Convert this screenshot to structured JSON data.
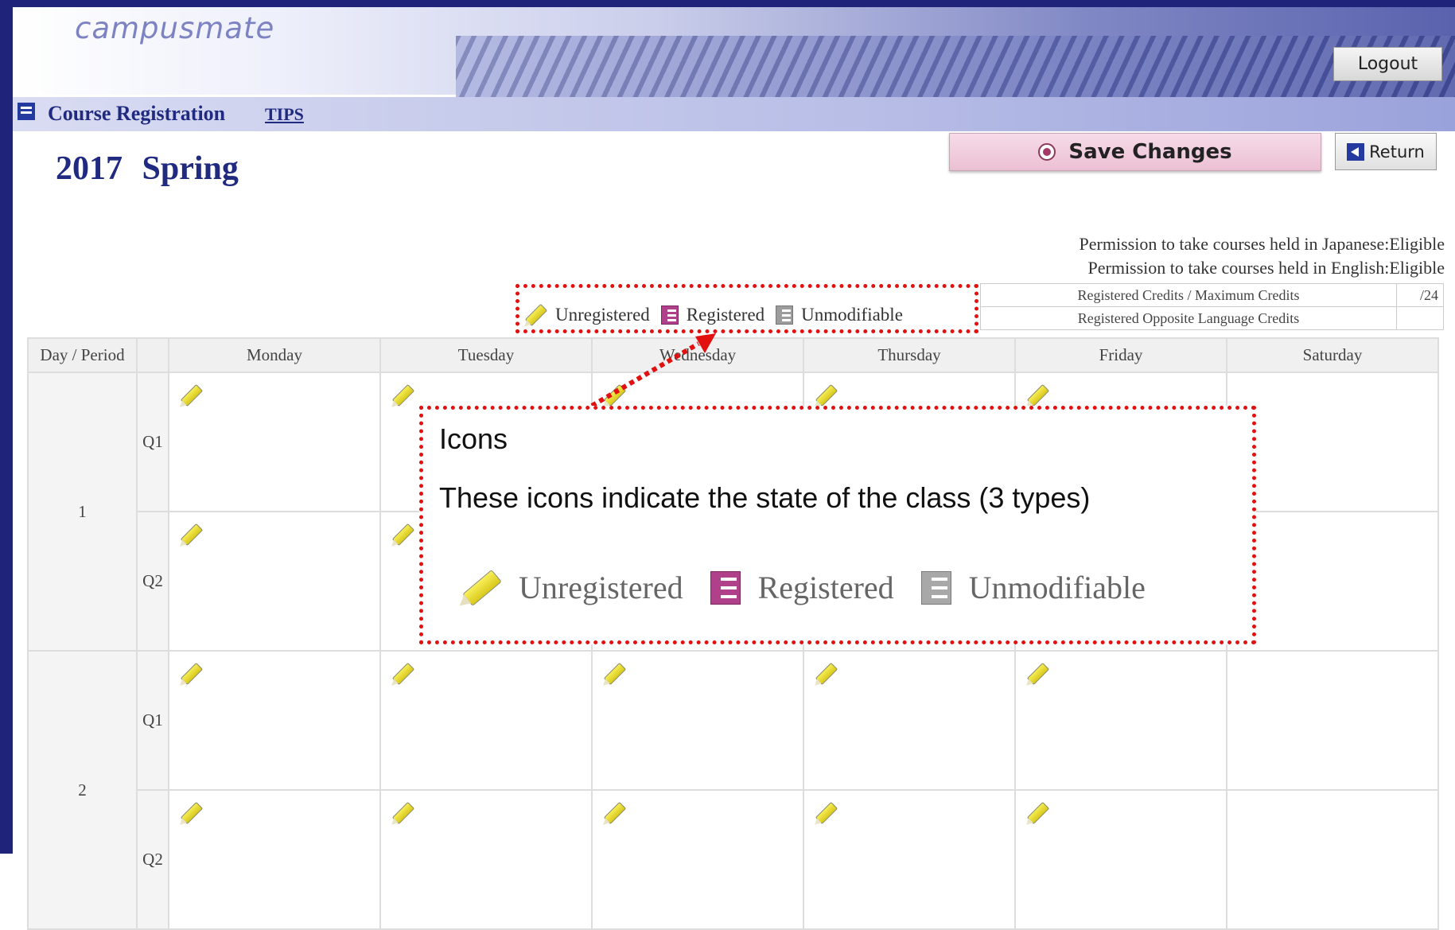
{
  "header": {
    "logo": "campusmate",
    "logout_label": "Logout"
  },
  "nav": {
    "title": "Course Registration",
    "tips": "TIPS"
  },
  "term": "2017 Spring",
  "actions": {
    "save_label": "Save Changes",
    "return_label": "Return"
  },
  "permissions": {
    "japanese": "Permission to take courses held in Japanese:Eligible",
    "english": "Permission to take courses held in English:Eligible"
  },
  "credits": {
    "registered_label": "Registered Credits / Maximum Credits",
    "registered_value": "/24",
    "opposite_label": "Registered Opposite Language Credits",
    "opposite_value": ""
  },
  "legend": {
    "unregistered": "Unregistered",
    "registered": "Registered",
    "unmodifiable": "Unmodifiable"
  },
  "grid": {
    "corner": "Day / Period",
    "days": [
      "Monday",
      "Tuesday",
      "Wednesday",
      "Thursday",
      "Friday",
      "Saturday"
    ],
    "periods": [
      {
        "label": "1",
        "quarters": [
          "Q1",
          "Q2"
        ]
      },
      {
        "label": "2",
        "quarters": [
          "Q1",
          "Q2"
        ]
      }
    ]
  },
  "callout": {
    "title": "Icons",
    "description": "These icons indicate the state of the class (3 types)",
    "unregistered": "Unregistered",
    "registered": "Registered",
    "unmodifiable": "Unmodifiable"
  },
  "colors": {
    "frame": "#1f237a",
    "title_text": "#1f2a80",
    "annotation": "#e31010",
    "registered_icon": "#b0408a"
  }
}
